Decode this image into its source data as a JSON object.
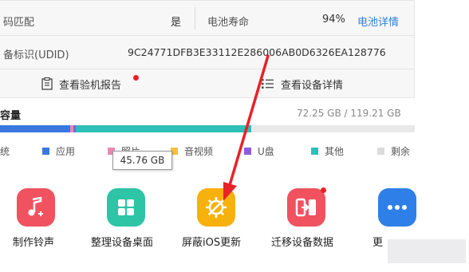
{
  "info": {
    "row1_left_label": "码匹配",
    "row1_left_value": "是",
    "row1_right_label": "电池寿命",
    "row1_right_value": "94%",
    "row1_right_link": "电池详情",
    "row2_label": "备标识(UDID)",
    "row2_value": "9C24771DFB3E33112E286006AB0D6326EA128776"
  },
  "actions": {
    "inspection_report": "查看验机报告",
    "device_details": "查看设备详情"
  },
  "capacity": {
    "title": "容量",
    "value": "72.25 GB / 119.21 GB",
    "used_fraction": 0.606
  },
  "legend": [
    {
      "label": "统",
      "color": "#3a78e0"
    },
    {
      "label": "应用",
      "color": "#3a78e0"
    },
    {
      "label": "照片",
      "color": "#e889b2"
    },
    {
      "label": "音视频",
      "color": "#f5c23c"
    },
    {
      "label": "U盘",
      "color": "#8d5ce0"
    },
    {
      "label": "其他",
      "color": "#2ec0b6"
    },
    {
      "label": "剩余",
      "color": "#dcdcdc"
    }
  ],
  "tooltip": "45.76 GB",
  "apps": [
    {
      "label": "制作铃声",
      "color": "#f0525f",
      "icon": "music-note-icon"
    },
    {
      "label": "整理设备桌面",
      "color": "#2ec4a6",
      "icon": "grid-icon"
    },
    {
      "label": "屏蔽iOS更新",
      "color": "#f7b10c",
      "icon": "gear-block-icon"
    },
    {
      "label": "迁移设备数据",
      "color": "#f0525f",
      "icon": "migrate-icon"
    },
    {
      "label": "更多",
      "color": "#2f7fe8",
      "icon": "more-dots-icon"
    }
  ],
  "colors": {
    "link": "#2f7fd8",
    "arrow": "#e8212a"
  }
}
